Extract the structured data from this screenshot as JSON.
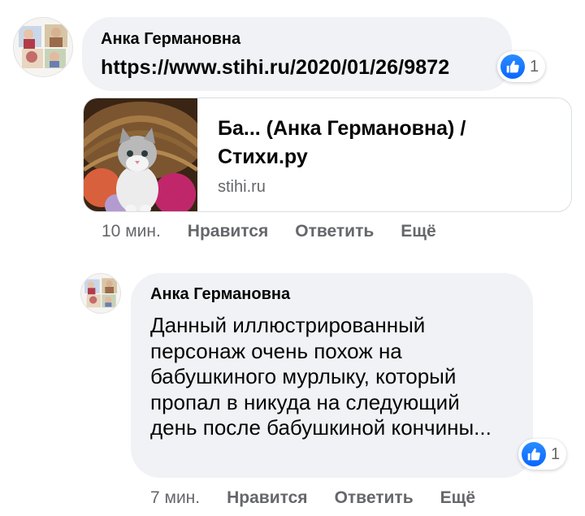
{
  "comments": [
    {
      "author": "Анка Германовна",
      "text": "https://www.stihi.ru/2020/01/26/9872",
      "reaction_count": "1",
      "preview": {
        "title": "Ба... (Анка Германовна) / Стихи.ру",
        "domain": "stihi.ru"
      },
      "actions": {
        "time": "10 мин.",
        "like": "Нравится",
        "reply": "Ответить",
        "more": "Ещё"
      }
    },
    {
      "author": "Анка Германовна",
      "text": "Данный иллюстрированный персонаж очень похож на бабушкиного мурлыку, который пропал в никуда на следующий день после бабушкиной кончины...",
      "reaction_count": "1",
      "actions": {
        "time": "7 мин.",
        "like": "Нравится",
        "reply": "Ответить",
        "more": "Ещё"
      }
    }
  ],
  "colors": {
    "bubble": "#f0f2f5",
    "like_blue": "#0866ff",
    "secondary_text": "#65676b"
  },
  "icons": [
    "like-icon",
    "kitten-thumbnail",
    "avatar-photo"
  ]
}
